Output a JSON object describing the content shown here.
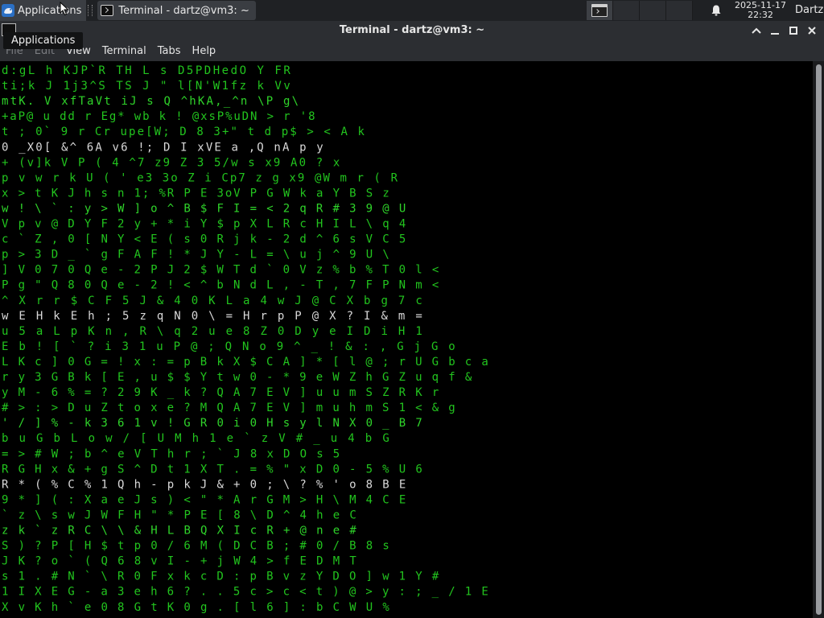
{
  "panel": {
    "applications_label": "Applications",
    "task_label": "Terminal - dartz@vm3: ~",
    "clock_date": "2025-11-17",
    "clock_time": "22:32",
    "user_label": "Dartz"
  },
  "tooltip": {
    "text": "Applications"
  },
  "window": {
    "title": "Terminal - dartz@vm3: ~"
  },
  "menubar": {
    "file": "File",
    "edit": "Edit",
    "view": "View",
    "terminal": "Terminal",
    "tabs": "Tabs",
    "help": "Help"
  },
  "colors": {
    "matrix_green": "#22c41e",
    "matrix_white": "#d9d9d9",
    "panel_bg": "#1f2124",
    "titlebar_bg": "#2c2e32"
  },
  "icons": {
    "apps": "xfce-mouse-icon",
    "task": "terminal-icon",
    "workspace": "terminal-icon",
    "notification": "bell-icon",
    "minimize": "minimize-icon",
    "maximize": "maximize-icon",
    "close": "close-icon",
    "roll_up": "chevron-up-icon"
  },
  "terminal": {
    "rain_lines": [
      "d:gL h KJP`R TH L s D5PDHedO  Y  FR",
      "ti;k J 1j3^S TS J \" l[N'W1fz  k  Vv",
      "mtK. V xfTaVt iJ s Q ^hKA,_^n \\P  g\\",
      "+aP@ u dd r Eg* wb k ! @xsP%uDN > r '8",
      "t ; 0` 9 r Cr upe[W; D 8 3+\" t d p$ > < A  k",
      "0 _X0[ &^ 6A v6 !; D I xVE a ,Q nA p  y",
      "+ (v]k V P ( 4 ^7 z9 Z 3 5/w s x9 A0 ?  x",
      "p v w r k U ( ' e3 3o Z i Cp7 z g x9 @W m r (  R",
      "x > t K J h s n 1; %R P E 3oV P G W k a Y B S z",
      "w ! \\ ` : y > W ] o ^ B $ F I = < 2 q R # 3 9 @ U",
      "V p v @ D Y F 2 y + * i Y $ p X L R c H I L \\ q 4",
      "c ` Z , 0 [ N Y < E ( s 0 R j k - 2 d ^ 6 s V C 5",
      "p > 3 D _ ` g F A F ! * J Y - L = \\ u j ^ 9 U \\",
      "] V 0 7 0 Q e - 2 P J 2 $ W T d ` 0 V z % b % T 0 l <",
      "P g \" Q 8 0 Q e - 2 ! < ^ b N d L , - T , 7 F P N m <",
      "  ^ X r r $ C F 5 J & 4 0 K L a 4 w J @ C X b g 7 c",
      "  w E H k E h ; 5 z q N 0 \\ = H r p P @ X ? I & m =",
      "  u 5 a L p K n , R \\ q 2 u e 8 Z 0 D y e I D i H 1",
      "  E b ! [ ` ? i 3 1 u P @ ; Q N o 9 ^ _ ! & : , G j G o",
      "L K c ] 0 G = ! x : = p B k X $ C A ] * [ l @ ; r U G b c a",
      "r y 3 G B k [ E , u $ $ Y t w 0 - * 9 e W Z h G Z u q f &",
      "y M - 6 % = ? 2 9 K _ k ? Q A 7 E V ] u u m S Z R K r",
      "# > : > D u Z t o x e ? M Q A 7 E V ] m u h m S 1 < & g",
      "' / ] % - k 3 6 1 v ! G R 0 i 0 H s y l N X 0 _ B 7",
      "  b u G b L o w / [ U M h 1 e ` z V # _ u 4 b G",
      "= > # W ; b ^ e V T h r ; ` J 8 x D O s 5",
      "R G H x & + g S ^ D t 1 X T . = % \" x D 0 - 5 % U 6",
      "R * ( % C % 1 Q h - p k J & + 0 ; \\ ? % ' o 8 B E",
      "9 * ] ( : X a e J s ) < \" * A r G M > H \\ M 4 C E",
      "` z \\ s w J W F H \" * P E [ 8 \\ D ^ 4 h e C",
      "z k ` z R C \\ \\ & H L B Q X I c R + @ n e #",
      "S ) ? P [ H $ t p 0 / 6 M ( D C B ; # 0 / B 8 s",
      "J K ? o ` ( Q 6 8 v I - + j W 4 > f E D M T",
      "s 1 . # N ` \\ R 0 F x k c D : p B v z Y D O ] w 1 Y #",
      "1 I X E G - a 3 e h 6 ? . . 5 c > c < t ) @ > y : ; _ / 1 E",
      "X v K h ` e 0 8 G t K 0 g . [ l 6 ] : b C W U %"
    ]
  }
}
